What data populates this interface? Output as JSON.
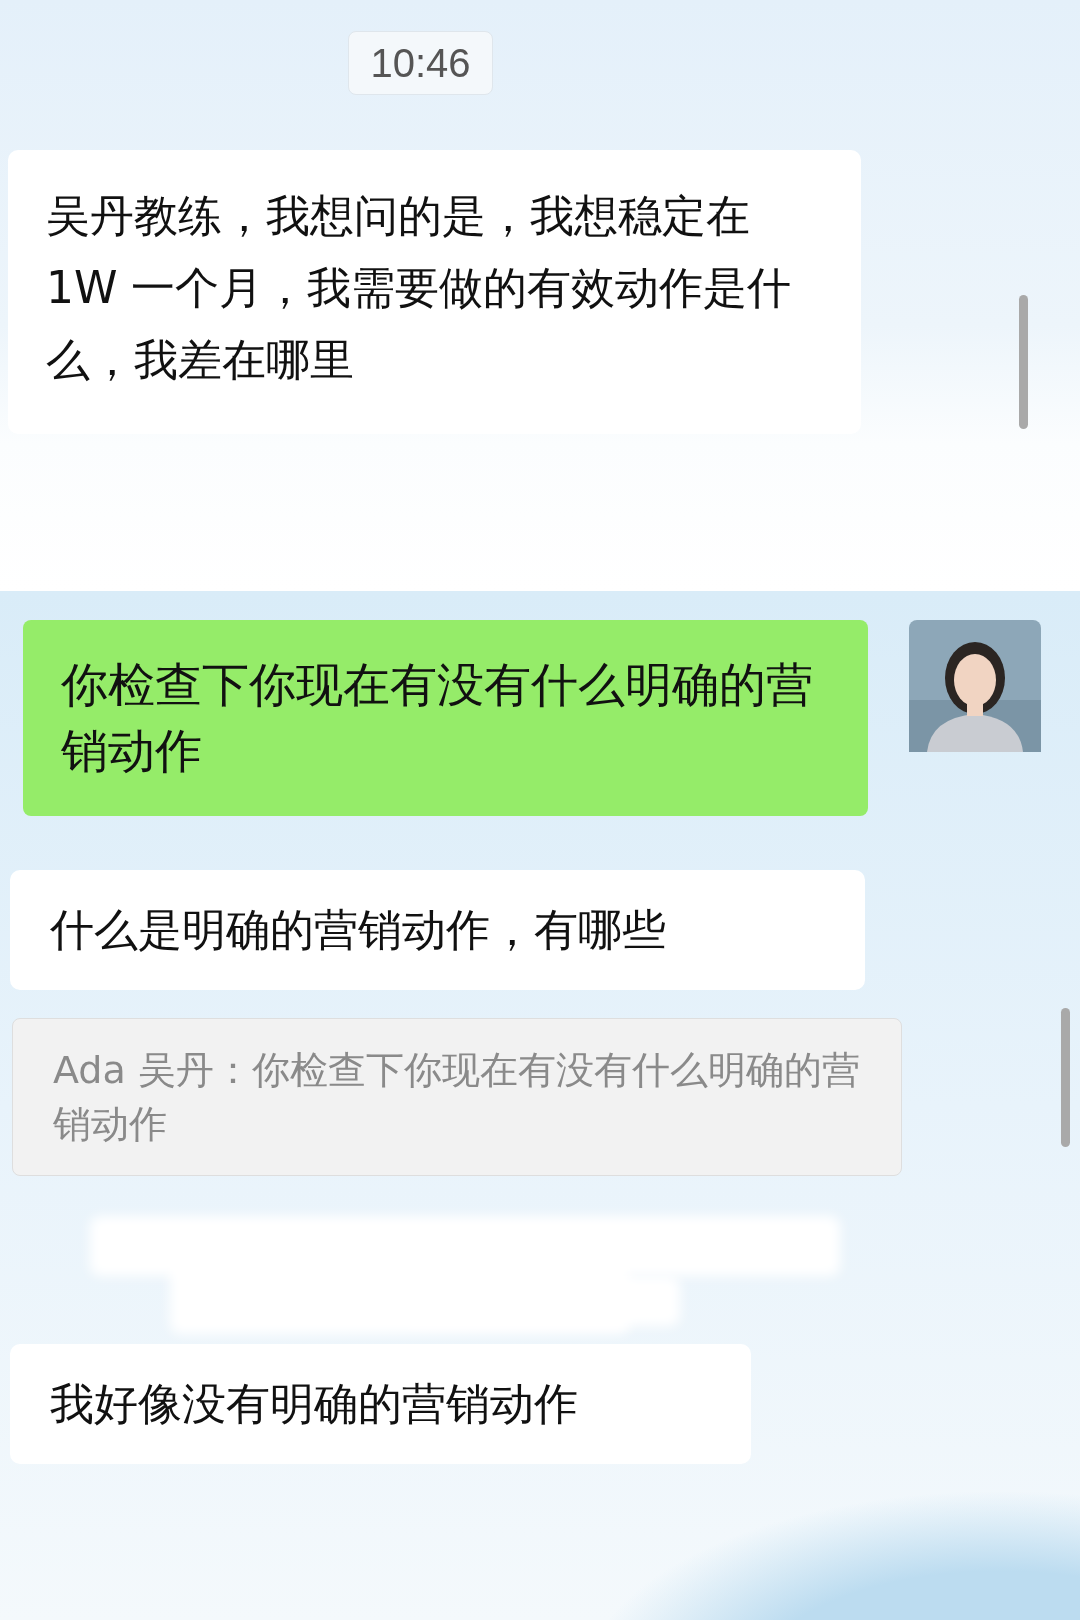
{
  "time": "10:46",
  "messages": [
    {
      "kind": "received",
      "text": "吴丹教练，我想问的是，我想稳定在 1W 一个月，我需要做的有效动作是什么，我差在哪里"
    },
    {
      "kind": "sent",
      "text": "你检查下你现在有没有什么明确的营销动作"
    },
    {
      "kind": "received",
      "text": "什么是明确的营销动作，有哪些"
    },
    {
      "kind": "quote",
      "text": "Ada 吴丹：你检查下你现在有没有什么明确的营销动作"
    },
    {
      "kind": "blurred"
    },
    {
      "kind": "received",
      "text": "我好像没有明确的营销动作"
    }
  ]
}
